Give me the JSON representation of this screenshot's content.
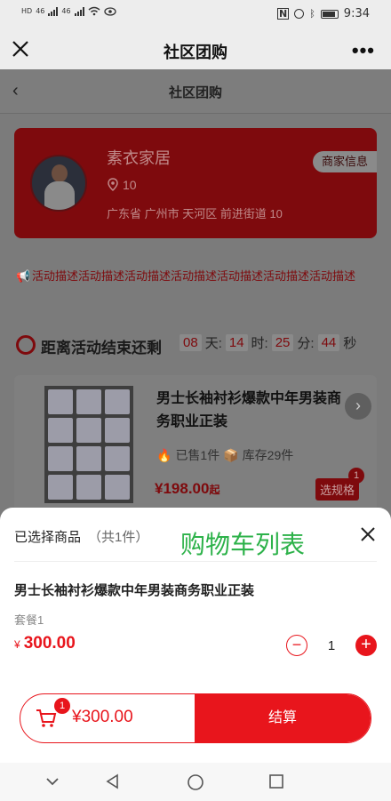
{
  "status_bar": {
    "left_labels": [
      "HD",
      "46",
      "46"
    ],
    "time": "9:34",
    "icons": [
      "nfc-icon",
      "alarm-icon",
      "bluetooth-icon",
      "battery-icon"
    ]
  },
  "title_bar": {
    "title": "社区团购"
  },
  "page": {
    "subnav_title": "社区团购",
    "shop": {
      "name": "素衣家居",
      "info_button": "商家信息",
      "count": "10",
      "address": "广东省 广州市 天河区 前进街道 10"
    },
    "description": "活动描述活动描述活动描述活动描述活动描述活动描述活动描述",
    "countdown": {
      "label": "距离活动结束还剩",
      "days": "08",
      "days_unit": "天:",
      "hours": "14",
      "hours_unit": "时:",
      "minutes": "25",
      "minutes_unit": "分:",
      "seconds": "44",
      "seconds_unit": "秒"
    },
    "product": {
      "name": "男士长袖衬衫爆款中年男装商务职业正装",
      "sold": "已售1件",
      "stock": "库存29件",
      "price": "¥198.00",
      "price_suffix": "起",
      "spec_button": "选规格",
      "spec_badge": "1"
    }
  },
  "sheet": {
    "header": "已选择商品",
    "count_text": "（共1件）",
    "overlay_caption": "购物车列表",
    "item": {
      "name": "男士长袖衬衫爆款中年男装商务职业正装",
      "package": "套餐1",
      "currency": "¥",
      "price": "300.00",
      "quantity": "1"
    },
    "checkout": {
      "cart_badge": "1",
      "total": "¥300.00",
      "pay_button": "结算"
    }
  },
  "colors": {
    "accent": "#e8151c",
    "caption_green": "#2db24a"
  }
}
